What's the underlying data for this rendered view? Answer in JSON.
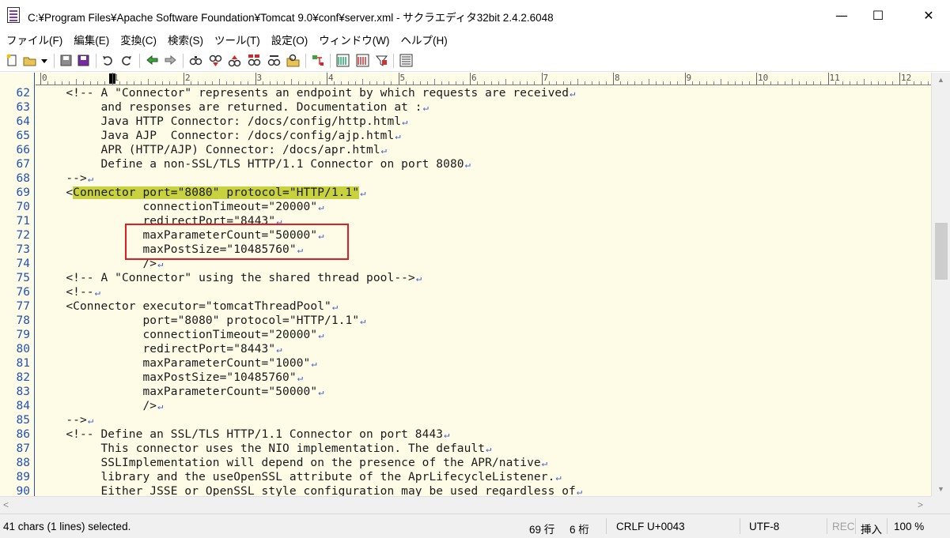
{
  "window": {
    "title": "C:¥Program Files¥Apache Software Foundation¥Tomcat 9.0¥conf¥server.xml - サクラエディタ32bit 2.4.2.6048",
    "minimize": "—",
    "maximize": "☐",
    "close": "✕"
  },
  "menu": [
    "ファイル(F)",
    "編集(E)",
    "変換(C)",
    "検索(S)",
    "ツール(T)",
    "設定(O)",
    "ウィンドウ(W)",
    "ヘルプ(H)"
  ],
  "toolbar": {
    "icons": [
      "new-file-icon",
      "open-file-icon",
      "dropdown-icon",
      "save-icon",
      "save-all-icon",
      "undo-icon",
      "redo-icon",
      "jump-back-icon",
      "jump-forward-icon",
      "search-icon",
      "search-next-icon",
      "search-prev-icon",
      "replace-icon",
      "mark-icon",
      "grep-icon",
      "outline-icon",
      "compare-icon",
      "bookmark-icon",
      "filter-icon",
      "settings-icon"
    ]
  },
  "ruler": {
    "numbers": [
      "0",
      "1",
      "2",
      "3",
      "4",
      "5",
      "6",
      "7",
      "8",
      "9",
      "10",
      "11",
      "12"
    ]
  },
  "editor": {
    "lines": [
      {
        "n": "62",
        "text": "    <!-- A \"Connector\" represents an endpoint by which requests are received",
        "eol": true
      },
      {
        "n": "63",
        "text": "         and responses are returned. Documentation at :",
        "eol": true
      },
      {
        "n": "64",
        "text": "         Java HTTP Connector: /docs/config/http.html",
        "eol": true
      },
      {
        "n": "65",
        "text": "         Java AJP  Connector: /docs/config/ajp.html",
        "eol": true
      },
      {
        "n": "66",
        "text": "         APR (HTTP/AJP) Connector: /docs/apr.html",
        "eol": true
      },
      {
        "n": "67",
        "text": "         Define a non-SSL/TLS HTTP/1.1 Connector on port 8080",
        "eol": true
      },
      {
        "n": "68",
        "text": "    -->",
        "eol": true
      },
      {
        "n": "69",
        "pre": "    <",
        "sel": "Connector port=\"8080\" protocol=\"HTTP/1.1\"",
        "text": "",
        "eol": true
      },
      {
        "n": "70",
        "text": "               connectionTimeout=\"20000\"",
        "eol": true
      },
      {
        "n": "71",
        "text": "               redirectPort=\"8443\"",
        "eol": true
      },
      {
        "n": "72",
        "text": "               maxParameterCount=\"50000\"",
        "eol": true
      },
      {
        "n": "73",
        "text": "               maxPostSize=\"10485760\"",
        "eol": true
      },
      {
        "n": "74",
        "text": "               />",
        "eol": true
      },
      {
        "n": "75",
        "text": "    <!-- A \"Connector\" using the shared thread pool-->",
        "eol": true
      },
      {
        "n": "76",
        "text": "    <!--",
        "eol": true
      },
      {
        "n": "77",
        "text": "    <Connector executor=\"tomcatThreadPool\"",
        "eol": true
      },
      {
        "n": "78",
        "text": "               port=\"8080\" protocol=\"HTTP/1.1\"",
        "eol": true
      },
      {
        "n": "79",
        "text": "               connectionTimeout=\"20000\"",
        "eol": true
      },
      {
        "n": "80",
        "text": "               redirectPort=\"8443\"",
        "eol": true
      },
      {
        "n": "81",
        "text": "               maxParameterCount=\"1000\"",
        "eol": true
      },
      {
        "n": "82",
        "text": "               maxPostSize=\"10485760\"",
        "eol": true
      },
      {
        "n": "83",
        "text": "               maxParameterCount=\"50000\"",
        "eol": true
      },
      {
        "n": "84",
        "text": "               />",
        "eol": true
      },
      {
        "n": "85",
        "text": "    -->",
        "eol": true
      },
      {
        "n": "86",
        "text": "    <!-- Define an SSL/TLS HTTP/1.1 Connector on port 8443",
        "eol": true
      },
      {
        "n": "87",
        "text": "         This connector uses the NIO implementation. The default",
        "eol": true
      },
      {
        "n": "88",
        "text": "         SSLImplementation will depend on the presence of the APR/native",
        "eol": true
      },
      {
        "n": "89",
        "text": "         library and the useOpenSSL attribute of the AprLifecycleListener.",
        "eol": true
      },
      {
        "n": "90",
        "text": "         Either JSSE or OpenSSL style configuration may be used regardless of",
        "eol": true
      }
    ],
    "eol_glyph": "↵"
  },
  "status": {
    "selection": "41 chars (1 lines) selected.",
    "line": "69 行",
    "column": "6 桁",
    "eol": "CRLF",
    "codepoint": "U+0043",
    "encoding": "UTF-8",
    "rec": "REC",
    "insert": "挿入",
    "zoom": "100 %"
  },
  "colors": {
    "editor_bg": "#fefbe6",
    "line_number": "#2050b8",
    "selection": "#c8d23f",
    "annotation": "#e31b23",
    "eol_mark": "#3a5fcd"
  }
}
